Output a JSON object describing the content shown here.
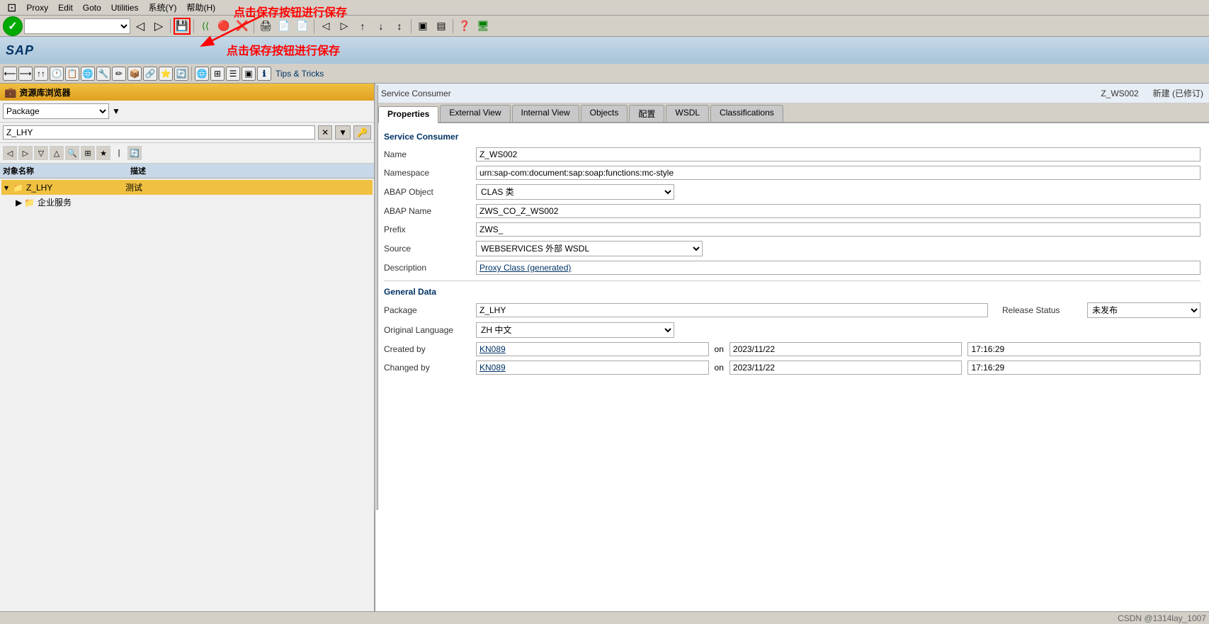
{
  "menubar": {
    "icon": "⊡",
    "items": [
      "Proxy",
      "Edit",
      "Goto",
      "Utilities",
      "系统(Y)",
      "帮助(H)"
    ]
  },
  "toolbar": {
    "command_field": "",
    "buttons": [
      {
        "icon": "✓",
        "name": "check-btn",
        "label": "Check"
      },
      {
        "icon": "💾",
        "name": "save-btn",
        "label": "Save",
        "highlight": true
      },
      {
        "icon": "⟨⟨",
        "name": "back-btn",
        "label": "Back"
      },
      {
        "icon": "🔴",
        "name": "stop-btn",
        "label": "Stop"
      },
      {
        "icon": "❌",
        "name": "cancel-btn",
        "label": "Cancel"
      }
    ]
  },
  "sap_header": {
    "logo": "SAP",
    "annotation": "点击保存按钮进行保存"
  },
  "toolbar2": {
    "tips_label": "Tips & Tricks"
  },
  "left_panel": {
    "title": "资源库浏览器",
    "package_label": "Package",
    "search_value": "Z_LHY",
    "tree": {
      "columns": [
        "对象名称",
        "描述"
      ],
      "items": [
        {
          "name": "Z_LHY",
          "desc": "测试",
          "level": 0,
          "type": "folder",
          "expanded": true,
          "selected": true
        },
        {
          "name": "企业服务",
          "desc": "",
          "level": 1,
          "type": "folder",
          "expanded": false,
          "selected": false
        }
      ]
    }
  },
  "right_panel": {
    "service_consumer_label": "Service Consumer",
    "service_consumer_name": "Z_WS002",
    "service_consumer_status": "新建 (已修订)",
    "tabs": [
      {
        "label": "Properties",
        "active": true
      },
      {
        "label": "External View",
        "active": false
      },
      {
        "label": "Internal View",
        "active": false
      },
      {
        "label": "Objects",
        "active": false
      },
      {
        "label": "配置",
        "active": false
      },
      {
        "label": "WSDL",
        "active": false
      },
      {
        "label": "Classifications",
        "active": false
      }
    ],
    "service_consumer_section": {
      "title": "Service Consumer",
      "fields": [
        {
          "label": "Name",
          "value": "Z_WS002",
          "type": "text"
        },
        {
          "label": "Namespace",
          "value": "urn:sap-com:document:sap:soap:functions:mc-style",
          "type": "text"
        },
        {
          "label": "ABAP Object",
          "value": "CLAS 类",
          "type": "select"
        },
        {
          "label": "ABAP Name",
          "value": "ZWS_CO_Z_WS002",
          "type": "text"
        },
        {
          "label": "Prefix",
          "value": "ZWS_",
          "type": "text"
        },
        {
          "label": "Source",
          "value": "WEBSERVICES 外部 WSDL",
          "type": "select"
        },
        {
          "label": "Description",
          "value": "Proxy Class (generated)",
          "type": "text",
          "underline": true
        }
      ]
    },
    "general_data_section": {
      "title": "General Data",
      "package_label": "Package",
      "package_value": "Z_LHY",
      "release_status_label": "Release Status",
      "release_status_value": "未发布",
      "original_language_label": "Original Language",
      "original_language_value": "ZH 中文",
      "created_by_label": "Created by",
      "created_by_value": "KN089",
      "created_on_label": "on",
      "created_on_date": "2023/11/22",
      "created_on_time": "17:16:29",
      "changed_by_label": "Changed by",
      "changed_by_value": "KN089",
      "changed_on_label": "on",
      "changed_on_date": "2023/11/22",
      "changed_on_time": "17:16:29"
    }
  },
  "status_bar": {
    "text": "CSDN @1314lay_1007"
  }
}
